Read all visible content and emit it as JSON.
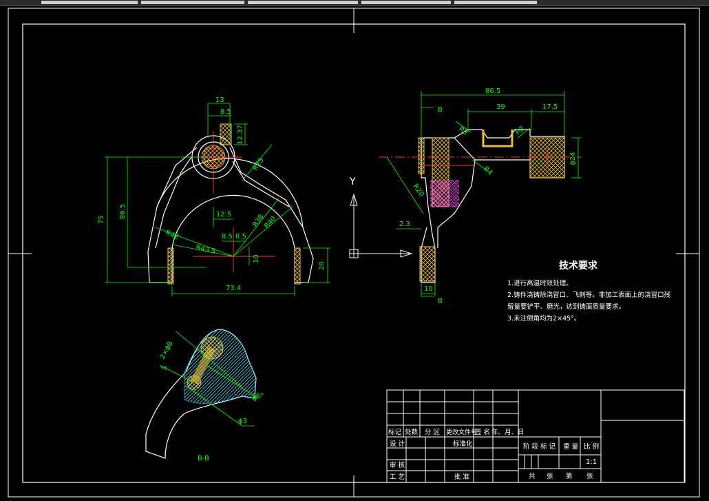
{
  "drawing": {
    "tech_title": "技术要求",
    "tech_notes": [
      "1.进行高温时效处理。",
      "2.铸件浇铸除浇冒口、飞刺等。非加工表面上的浇冒口残",
      "留量要铲平、磨光，达到铸面质量要求。",
      "3.未注倒角均为2×45°。"
    ],
    "section_label": "B-B",
    "axis_y_label": "Y",
    "dims": {
      "d13": "13",
      "d8_5a": "8.5",
      "d12_37": "12.37",
      "r25": "R25",
      "d75": "75",
      "d86_5a": "86.5",
      "d12_5": "12.5",
      "r38": "R38",
      "r40": "R40",
      "r42": "R42",
      "d8_5b": "8.5",
      "d8_5c": "8.5",
      "r43_5": "R43.5",
      "d10a": "10",
      "d20": "20",
      "d73_4": "73.4",
      "d86_5b": "86.5",
      "b_top": "B",
      "d39": "39",
      "d17_5": "17.5",
      "r3": "R3",
      "r2": "R2",
      "phi24": "ϕ24",
      "r4": "R4",
      "r20": "R20",
      "d2_3": "2.3",
      "d10b": "10",
      "b_bot": "B",
      "phi8": "ϕ8 ͣ",
      "d2phi8": "2×ϕ8",
      "d5": "5",
      "phi3": "ϕ3"
    }
  },
  "title_block": {
    "row_labels": [
      "标记",
      "处数",
      "分 区",
      "更改文件号",
      "签 名",
      "年、月、日"
    ],
    "design": "设 计",
    "standardize": "标准化",
    "stage_labels": [
      "阶 段 标 记",
      "重 量",
      "比 例"
    ],
    "scale": "1:1",
    "review": "审 核",
    "process": "工 艺",
    "approve": "批 准",
    "sheet_labels": [
      "共",
      "张",
      "第",
      "张"
    ]
  }
}
